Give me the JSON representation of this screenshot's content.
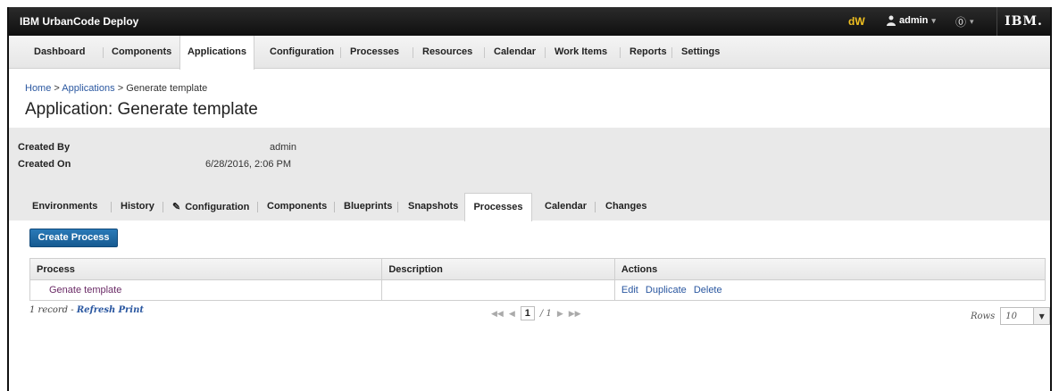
{
  "header": {
    "brand": "IBM UrbanCode Deploy",
    "dw": "dW",
    "user": "admin",
    "help_icon": "help-icon",
    "ibm_logo": "IBM."
  },
  "nav": [
    {
      "label": "Dashboard"
    },
    {
      "label": "Components"
    },
    {
      "label": "Applications",
      "active": true
    },
    {
      "label": "Configuration"
    },
    {
      "label": "Processes"
    },
    {
      "label": "Resources"
    },
    {
      "label": "Calendar"
    },
    {
      "label": "Work Items"
    },
    {
      "label": "Reports"
    },
    {
      "label": "Settings"
    }
  ],
  "breadcrumb": {
    "home": "Home",
    "sep1": ">",
    "applications": "Applications",
    "sep2": ">",
    "current": "Generate template"
  },
  "page_title": "Application: Generate template",
  "info": {
    "created_by_label": "Created By",
    "created_by": "admin",
    "created_on_label": "Created On",
    "created_on": "6/28/2016, 2:06 PM"
  },
  "tabs": [
    {
      "label": "Environments"
    },
    {
      "label": "History"
    },
    {
      "label": "Configuration",
      "icon": "wrench-icon"
    },
    {
      "label": "Components"
    },
    {
      "label": "Blueprints"
    },
    {
      "label": "Snapshots"
    },
    {
      "label": "Processes",
      "active": true
    },
    {
      "label": "Calendar"
    },
    {
      "label": "Changes"
    }
  ],
  "create_button": "Create Process",
  "table": {
    "headers": [
      "Process",
      "Description",
      "Actions"
    ],
    "rows": [
      {
        "process": "Genate template",
        "description": "",
        "actions": [
          "Edit",
          "Duplicate",
          "Delete"
        ]
      }
    ]
  },
  "footer": {
    "count": "1 record",
    "dash": "-",
    "refresh": "Refresh",
    "print": "Print",
    "page": "1",
    "of": "/ 1",
    "rows_label": "Rows",
    "rows_value": "10"
  },
  "colors": {
    "accent": "#1f6aa5",
    "topbar": "#1a1a1a",
    "link": "#2a57a0"
  }
}
